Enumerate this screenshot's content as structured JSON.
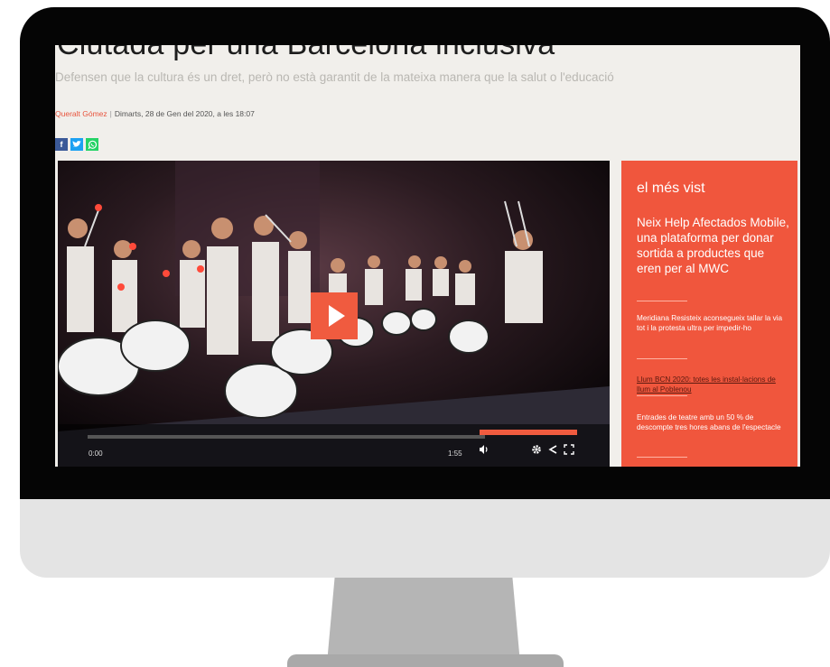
{
  "article": {
    "headline": "Ciutada per una Barcelona inclusiva",
    "subtitle": "Defensen que la cultura és un dret, però no està garantit de la mateixa manera que la salut o l'educació",
    "author": "Queralt Gómez",
    "date": "Dimarts, 28 de Gen del 2020, a les 18:07"
  },
  "share": {
    "facebook": "f",
    "twitter": "t",
    "whatsapp": "w"
  },
  "video": {
    "current_time": "0:00",
    "duration": "1:55",
    "progress": 0,
    "volume": 1.0
  },
  "sidebar": {
    "title": "el més vist",
    "feature": "Neix Help Afectados Mobile, una plataforma per donar sortida a productes que eren per al MWC",
    "items": [
      {
        "text": "Meridiana Resisteix aconsegueix tallar la via tot i la protesta ultra per impedir-ho"
      },
      {
        "text": "Llum BCN 2020: totes les instal·lacions de llum al Poblenou"
      },
      {
        "text": "Entrades de teatre amb un 50 % de descompte tres hores abans de l'espectacle"
      }
    ]
  },
  "colors": {
    "accent": "#f0563d",
    "screen_bg": "#f1efeb"
  }
}
